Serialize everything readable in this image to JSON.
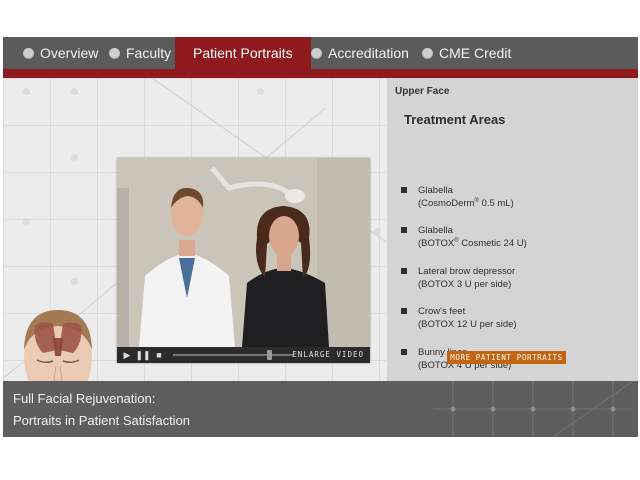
{
  "nav": {
    "tabs": [
      {
        "label": "Overview"
      },
      {
        "label": "Faculty"
      },
      {
        "label": "Patient Portraits"
      },
      {
        "label": "Accreditation"
      },
      {
        "label": "CME Credit"
      }
    ],
    "active_tab": "Patient Portraits",
    "accent_color": "#8e1a1e"
  },
  "video": {
    "enlarge_label": "ENLARGE VIDEO",
    "playback_position": 0.8
  },
  "panel": {
    "section_title": "Upper Face",
    "heading": "Treatment Areas",
    "items": [
      {
        "line1": "Glabella",
        "line2_pre": "(CosmoDerm",
        "line2_reg": "®",
        "line2_post": " 0.5 mL)"
      },
      {
        "line1": "Glabella",
        "line2_pre": "(BOTOX",
        "line2_reg": "®",
        "line2_post": " Cosmetic 24 U)"
      },
      {
        "line1": "Lateral brow depressor",
        "line2_pre": "(BOTOX 3 U per side)",
        "line2_reg": "",
        "line2_post": ""
      },
      {
        "line1": "Crow's feet",
        "line2_pre": "(BOTOX 12 U per side)",
        "line2_reg": "",
        "line2_post": ""
      },
      {
        "line1": "Bunny lines",
        "line2_pre": "(BOTOX 4 U per side)",
        "line2_reg": "",
        "line2_post": ""
      }
    ],
    "more_button": "MORE PATIENT PORTRAITS",
    "button_color": "#c4640f"
  },
  "footer": {
    "line1": "Full Facial Rejuvenation:",
    "line2": "Portraits in Patient Satisfaction"
  }
}
